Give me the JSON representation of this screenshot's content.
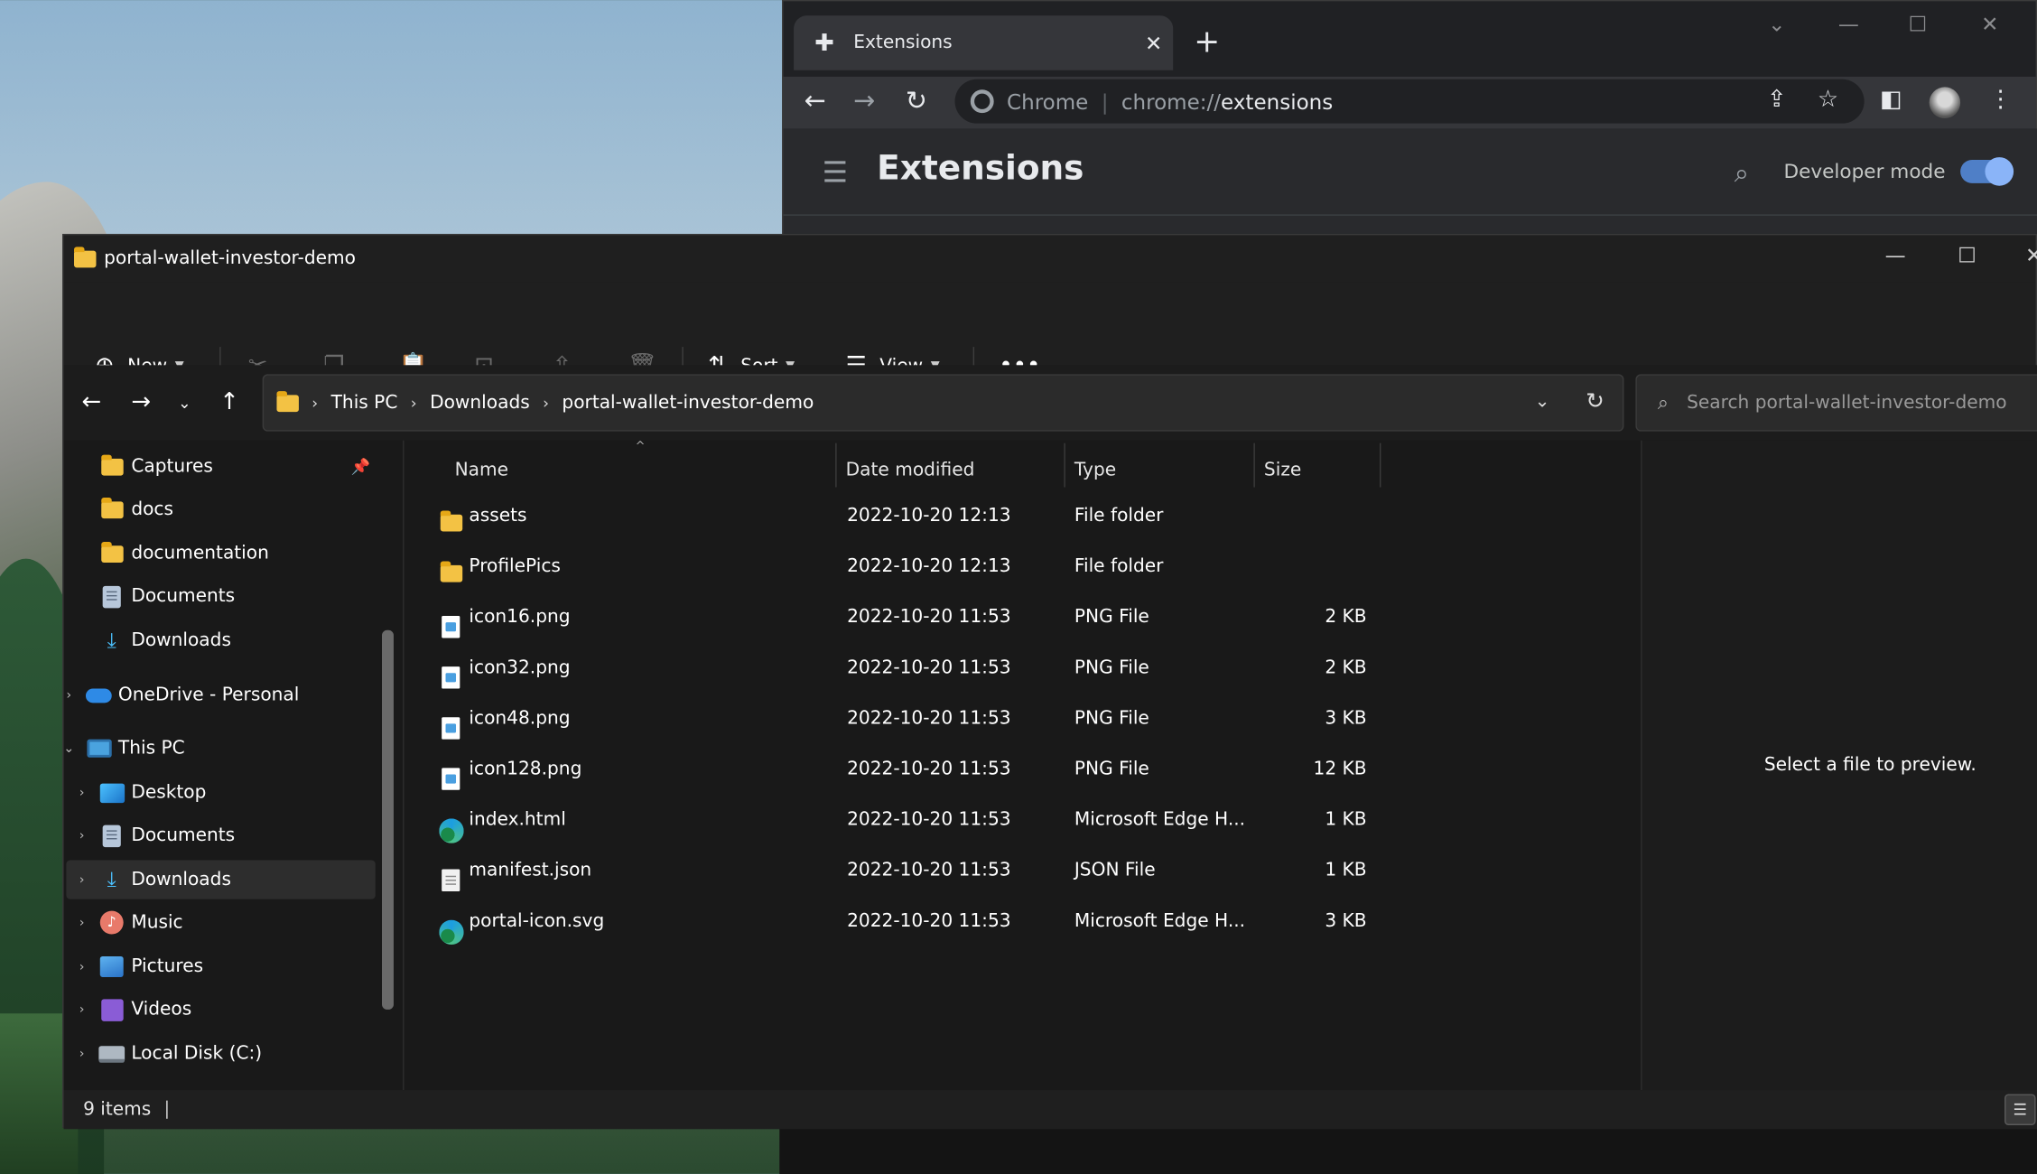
{
  "chrome": {
    "tab_title": "Extensions",
    "omnibox_origin": "Chrome",
    "omnibox_scheme": "chrome://",
    "omnibox_path": "extensions",
    "page_title": "Extensions",
    "developer_mode_label": "Developer mode",
    "developer_mode_on": true
  },
  "explorer": {
    "window_title": "portal-wallet-investor-demo",
    "commands": {
      "new_label": "New",
      "sort_label": "Sort",
      "view_label": "View"
    },
    "breadcrumb": [
      "This PC",
      "Downloads",
      "portal-wallet-investor-demo"
    ],
    "search_placeholder": "Search portal-wallet-investor-demo",
    "nav": [
      {
        "label": "Captures",
        "icon": "folder-icon",
        "pinned": true
      },
      {
        "label": "docs",
        "icon": "folder-icon"
      },
      {
        "label": "documentation",
        "icon": "folder-icon"
      },
      {
        "label": "Documents",
        "icon": "documents-icon"
      },
      {
        "label": "Downloads",
        "icon": "download-icon"
      },
      {
        "label": "OneDrive - Personal",
        "icon": "onedrive-icon"
      },
      {
        "label": "This PC",
        "icon": "this-pc-icon"
      },
      {
        "label": "Desktop",
        "icon": "desktop-icon"
      },
      {
        "label": "Documents",
        "icon": "documents-icon"
      },
      {
        "label": "Downloads",
        "icon": "download-icon"
      },
      {
        "label": "Music",
        "icon": "music-icon"
      },
      {
        "label": "Pictures",
        "icon": "pictures-icon"
      },
      {
        "label": "Videos",
        "icon": "videos-icon"
      },
      {
        "label": "Local Disk (C:)",
        "icon": "disk-icon"
      }
    ],
    "columns": {
      "name": "Name",
      "date": "Date modified",
      "type": "Type",
      "size": "Size"
    },
    "files": [
      {
        "name": "assets",
        "date": "2022-10-20 12:13",
        "type": "File folder",
        "size": "",
        "icon": "folder-icon"
      },
      {
        "name": "ProfilePics",
        "date": "2022-10-20 12:13",
        "type": "File folder",
        "size": "",
        "icon": "folder-icon"
      },
      {
        "name": "icon16.png",
        "date": "2022-10-20 11:53",
        "type": "PNG File",
        "size": "2 KB",
        "icon": "png-file-icon"
      },
      {
        "name": "icon32.png",
        "date": "2022-10-20 11:53",
        "type": "PNG File",
        "size": "2 KB",
        "icon": "png-file-icon"
      },
      {
        "name": "icon48.png",
        "date": "2022-10-20 11:53",
        "type": "PNG File",
        "size": "3 KB",
        "icon": "png-file-icon"
      },
      {
        "name": "icon128.png",
        "date": "2022-10-20 11:53",
        "type": "PNG File",
        "size": "12 KB",
        "icon": "png-file-icon"
      },
      {
        "name": "index.html",
        "date": "2022-10-20 11:53",
        "type": "Microsoft Edge H...",
        "size": "1 KB",
        "icon": "edge-file-icon"
      },
      {
        "name": "manifest.json",
        "date": "2022-10-20 11:53",
        "type": "JSON File",
        "size": "1 KB",
        "icon": "json-file-icon"
      },
      {
        "name": "portal-icon.svg",
        "date": "2022-10-20 11:53",
        "type": "Microsoft Edge H...",
        "size": "3 KB",
        "icon": "edge-file-icon"
      }
    ],
    "preview_text": "Select a file to preview.",
    "status_text": "9 items"
  }
}
